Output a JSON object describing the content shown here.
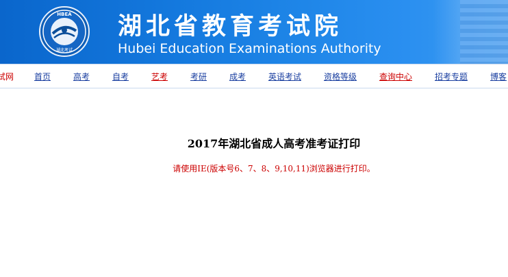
{
  "header": {
    "logo_text": "HBEA 湖北考试",
    "title_cn": "湖北省教育考试院",
    "title_en": "Hubei Education Examinations Authority"
  },
  "nav": {
    "items": [
      {
        "label": "试网"
      },
      {
        "label": "首页"
      },
      {
        "label": "高考"
      },
      {
        "label": "自考"
      },
      {
        "label": "艺考"
      },
      {
        "label": "考研"
      },
      {
        "label": "成考"
      },
      {
        "label": "英语考试"
      },
      {
        "label": "资格等级"
      },
      {
        "label": "查询中心"
      },
      {
        "label": "招考专题"
      },
      {
        "label": "博客"
      }
    ]
  },
  "main": {
    "heading": "2017年湖北省成人高考准考证打印",
    "notice": "请使用IE(版本号6、7、8、9,10,11)浏览器进行打印。"
  },
  "colors": {
    "banner_blue": "#1479de",
    "nav_link": "#1a3fa0",
    "nav_link_active": "#cc0000",
    "notice_red": "#cc0000"
  }
}
